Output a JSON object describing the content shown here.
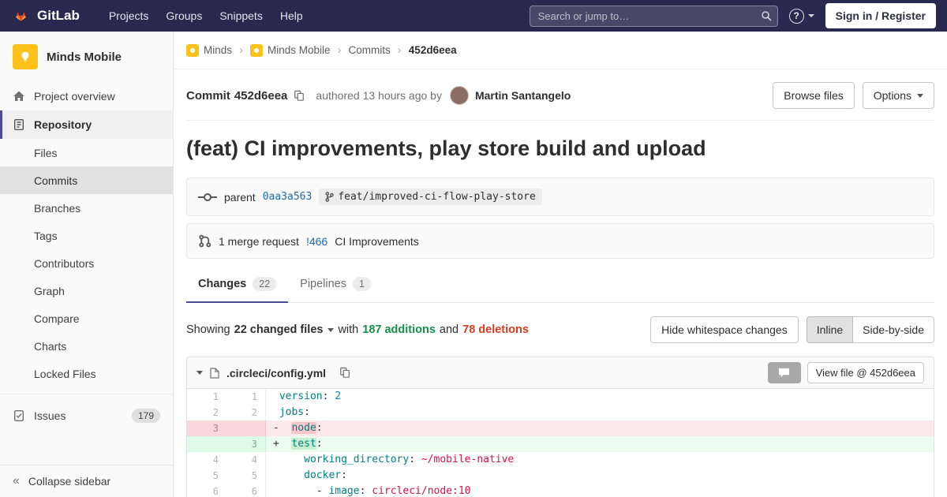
{
  "colors": {
    "navbar-bg": "#29294f",
    "accent": "#4b4b8f",
    "link": "#1b69b6",
    "added-text": "#168f48",
    "removed-text": "#db3b21",
    "avatar-bg": "#fcc21b",
    "key": "#008080",
    "string": "#d14",
    "number": "#0086b3"
  },
  "navbar": {
    "brand": "GitLab",
    "menu": [
      "Projects",
      "Groups",
      "Snippets",
      "Help"
    ],
    "search_placeholder": "Search or jump to…",
    "sign_in_label": "Sign in / Register"
  },
  "sidebar": {
    "project_name": "Minds Mobile",
    "overview_label": "Project overview",
    "repository_label": "Repository",
    "repo_items": [
      "Files",
      "Commits",
      "Branches",
      "Tags",
      "Contributors",
      "Graph",
      "Compare",
      "Charts",
      "Locked Files"
    ],
    "active_repo_item": "Commits",
    "issues_label": "Issues",
    "issues_count": "179",
    "collapse_label": "Collapse sidebar"
  },
  "breadcrumb": [
    "Minds",
    "Minds Mobile",
    "Commits",
    "452d6eea"
  ],
  "commit": {
    "label": "Commit",
    "sha": "452d6eea",
    "authored_text": "authored 13 hours ago by",
    "author_name": "Martin Santangelo",
    "browse_files_label": "Browse files",
    "options_label": "Options",
    "title": "(feat) CI improvements, play store build and upload",
    "parent_label": "parent",
    "parent_sha": "0aa3a563",
    "branch_name": "feat/improved-ci-flow-play-store",
    "mr_count_text": "1 merge request",
    "mr_ref": "!466",
    "mr_title": "CI Improvements"
  },
  "tabs": [
    {
      "label": "Changes",
      "count": "22",
      "active": true
    },
    {
      "label": "Pipelines",
      "count": "1",
      "active": false
    }
  ],
  "summary": {
    "showing_label": "Showing",
    "changed_files": "22 changed files",
    "with_label": "with",
    "additions": "187 additions",
    "and_label": "and",
    "deletions": "78 deletions",
    "hide_whitespace_label": "Hide whitespace changes",
    "inline_label": "Inline",
    "side_by_side_label": "Side-by-side"
  },
  "diff": {
    "file_name": ".circleci/config.yml",
    "view_file_label": "View file @ 452d6eea",
    "lines": [
      {
        "old": "1",
        "new": "1",
        "type": "context",
        "segments": [
          [
            "p",
            " "
          ],
          [
            "key",
            "version"
          ],
          [
            "p",
            ":"
          ],
          [
            "num",
            " 2"
          ]
        ]
      },
      {
        "old": "2",
        "new": "2",
        "type": "context",
        "segments": [
          [
            "p",
            " "
          ],
          [
            "key",
            "jobs"
          ],
          [
            "p",
            ":"
          ]
        ]
      },
      {
        "old": "3",
        "new": "",
        "type": "removed",
        "segments": [
          [
            "p",
            "-  "
          ],
          [
            "kr",
            "node"
          ],
          [
            "p",
            ":"
          ]
        ]
      },
      {
        "old": "",
        "new": "3",
        "type": "added",
        "segments": [
          [
            "p",
            "+  "
          ],
          [
            "kg",
            "test"
          ],
          [
            "p",
            ":"
          ]
        ]
      },
      {
        "old": "4",
        "new": "4",
        "type": "context",
        "segments": [
          [
            "p",
            "     "
          ],
          [
            "key",
            "working_directory"
          ],
          [
            "p",
            ": "
          ],
          [
            "str",
            "~/mobile-native"
          ]
        ]
      },
      {
        "old": "5",
        "new": "5",
        "type": "context",
        "segments": [
          [
            "p",
            "     "
          ],
          [
            "key",
            "docker"
          ],
          [
            "p",
            ":"
          ]
        ]
      },
      {
        "old": "6",
        "new": "6",
        "type": "context",
        "segments": [
          [
            "p",
            "       - "
          ],
          [
            "key",
            "image"
          ],
          [
            "p",
            ": "
          ],
          [
            "str",
            "circleci/node:10"
          ]
        ]
      }
    ]
  }
}
